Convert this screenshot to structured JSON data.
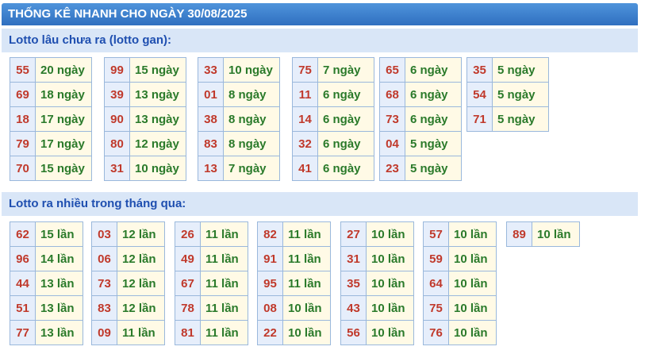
{
  "header": {
    "title": "THỐNG KÊ NHANH CHO NGÀY 30/08/2025"
  },
  "gan": {
    "title": "Lotto lâu chưa ra (lotto gan):",
    "groups": [
      [
        {
          "num": "55",
          "val": "20 ngày"
        },
        {
          "num": "69",
          "val": "18 ngày"
        },
        {
          "num": "18",
          "val": "17 ngày"
        },
        {
          "num": "79",
          "val": "17 ngày"
        },
        {
          "num": "70",
          "val": "15 ngày"
        }
      ],
      [
        {
          "num": "99",
          "val": "15 ngày"
        },
        {
          "num": "39",
          "val": "13 ngày"
        },
        {
          "num": "90",
          "val": "13 ngày"
        },
        {
          "num": "80",
          "val": "12 ngày"
        },
        {
          "num": "31",
          "val": "10 ngày"
        }
      ],
      [
        {
          "num": "33",
          "val": "10 ngày"
        },
        {
          "num": "01",
          "val": "8 ngày"
        },
        {
          "num": "38",
          "val": "8 ngày"
        },
        {
          "num": "83",
          "val": "8 ngày"
        },
        {
          "num": "13",
          "val": "7 ngày"
        }
      ],
      [
        {
          "num": "75",
          "val": "7 ngày"
        },
        {
          "num": "11",
          "val": "6 ngày"
        },
        {
          "num": "14",
          "val": "6 ngày"
        },
        {
          "num": "32",
          "val": "6 ngày"
        },
        {
          "num": "41",
          "val": "6 ngày"
        }
      ],
      [
        {
          "num": "65",
          "val": "6 ngày"
        },
        {
          "num": "68",
          "val": "6 ngày"
        },
        {
          "num": "73",
          "val": "6 ngày"
        },
        {
          "num": "04",
          "val": "5 ngày"
        },
        {
          "num": "23",
          "val": "5 ngày"
        }
      ],
      [
        {
          "num": "35",
          "val": "5 ngày"
        },
        {
          "num": "54",
          "val": "5 ngày"
        },
        {
          "num": "71",
          "val": "5 ngày"
        }
      ]
    ]
  },
  "freq": {
    "title": "Lotto ra nhiều trong tháng qua:",
    "groups": [
      [
        {
          "num": "62",
          "val": "15 lần"
        },
        {
          "num": "96",
          "val": "14 lần"
        },
        {
          "num": "44",
          "val": "13 lần"
        },
        {
          "num": "51",
          "val": "13 lần"
        },
        {
          "num": "77",
          "val": "13 lần"
        }
      ],
      [
        {
          "num": "03",
          "val": "12 lần"
        },
        {
          "num": "06",
          "val": "12 lần"
        },
        {
          "num": "73",
          "val": "12 lần"
        },
        {
          "num": "83",
          "val": "12 lần"
        },
        {
          "num": "09",
          "val": "11 lần"
        }
      ],
      [
        {
          "num": "26",
          "val": "11 lần"
        },
        {
          "num": "49",
          "val": "11 lần"
        },
        {
          "num": "67",
          "val": "11 lần"
        },
        {
          "num": "78",
          "val": "11 lần"
        },
        {
          "num": "81",
          "val": "11 lần"
        }
      ],
      [
        {
          "num": "82",
          "val": "11 lần"
        },
        {
          "num": "91",
          "val": "11 lần"
        },
        {
          "num": "95",
          "val": "11 lần"
        },
        {
          "num": "08",
          "val": "10 lần"
        },
        {
          "num": "22",
          "val": "10 lần"
        }
      ],
      [
        {
          "num": "27",
          "val": "10 lần"
        },
        {
          "num": "31",
          "val": "10 lần"
        },
        {
          "num": "35",
          "val": "10 lần"
        },
        {
          "num": "43",
          "val": "10 lần"
        },
        {
          "num": "56",
          "val": "10 lần"
        }
      ],
      [
        {
          "num": "57",
          "val": "10 lần"
        },
        {
          "num": "59",
          "val": "10 lần"
        },
        {
          "num": "64",
          "val": "10 lần"
        },
        {
          "num": "75",
          "val": "10 lần"
        },
        {
          "num": "76",
          "val": "10 lần"
        }
      ],
      [
        {
          "num": "89",
          "val": "10 lần"
        }
      ]
    ]
  }
}
